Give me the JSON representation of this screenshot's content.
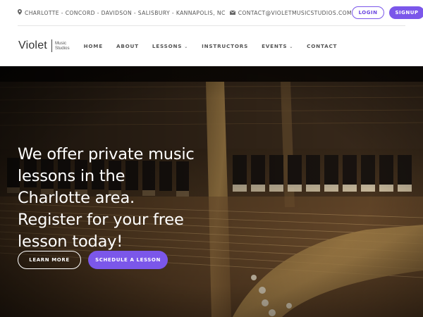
{
  "topbar": {
    "locations": "CHARLOTTE - CONCORD - DAVIDSON - SALISBURY - KANNAPOLIS, NC",
    "email": "CONTACT@VIOLETMUSICSTUDIOS.COM",
    "login_label": "LOGIN",
    "signup_label": "SIGNUP"
  },
  "logo": {
    "name": "Violet",
    "sub_line1": "Music",
    "sub_line2": "Studios"
  },
  "nav": {
    "items": [
      {
        "label": "HOME"
      },
      {
        "label": "ABOUT"
      },
      {
        "label": "LESSONS"
      },
      {
        "label": "INSTRUCTORS"
      },
      {
        "label": "EVENTS"
      },
      {
        "label": "CONTACT"
      }
    ]
  },
  "hero": {
    "headline": "We offer private music lessons in the Charlotte area. Register for your free lesson today!",
    "learn_more_label": "LEARN MORE",
    "schedule_label": "SCHEDULE A LESSON"
  },
  "icons": {
    "location": "map-pin-icon",
    "email": "envelope-icon",
    "dropdown": "chevron-down-icon"
  },
  "colors": {
    "accent": "#7b57ea",
    "hero_bg": "#1c130b"
  }
}
